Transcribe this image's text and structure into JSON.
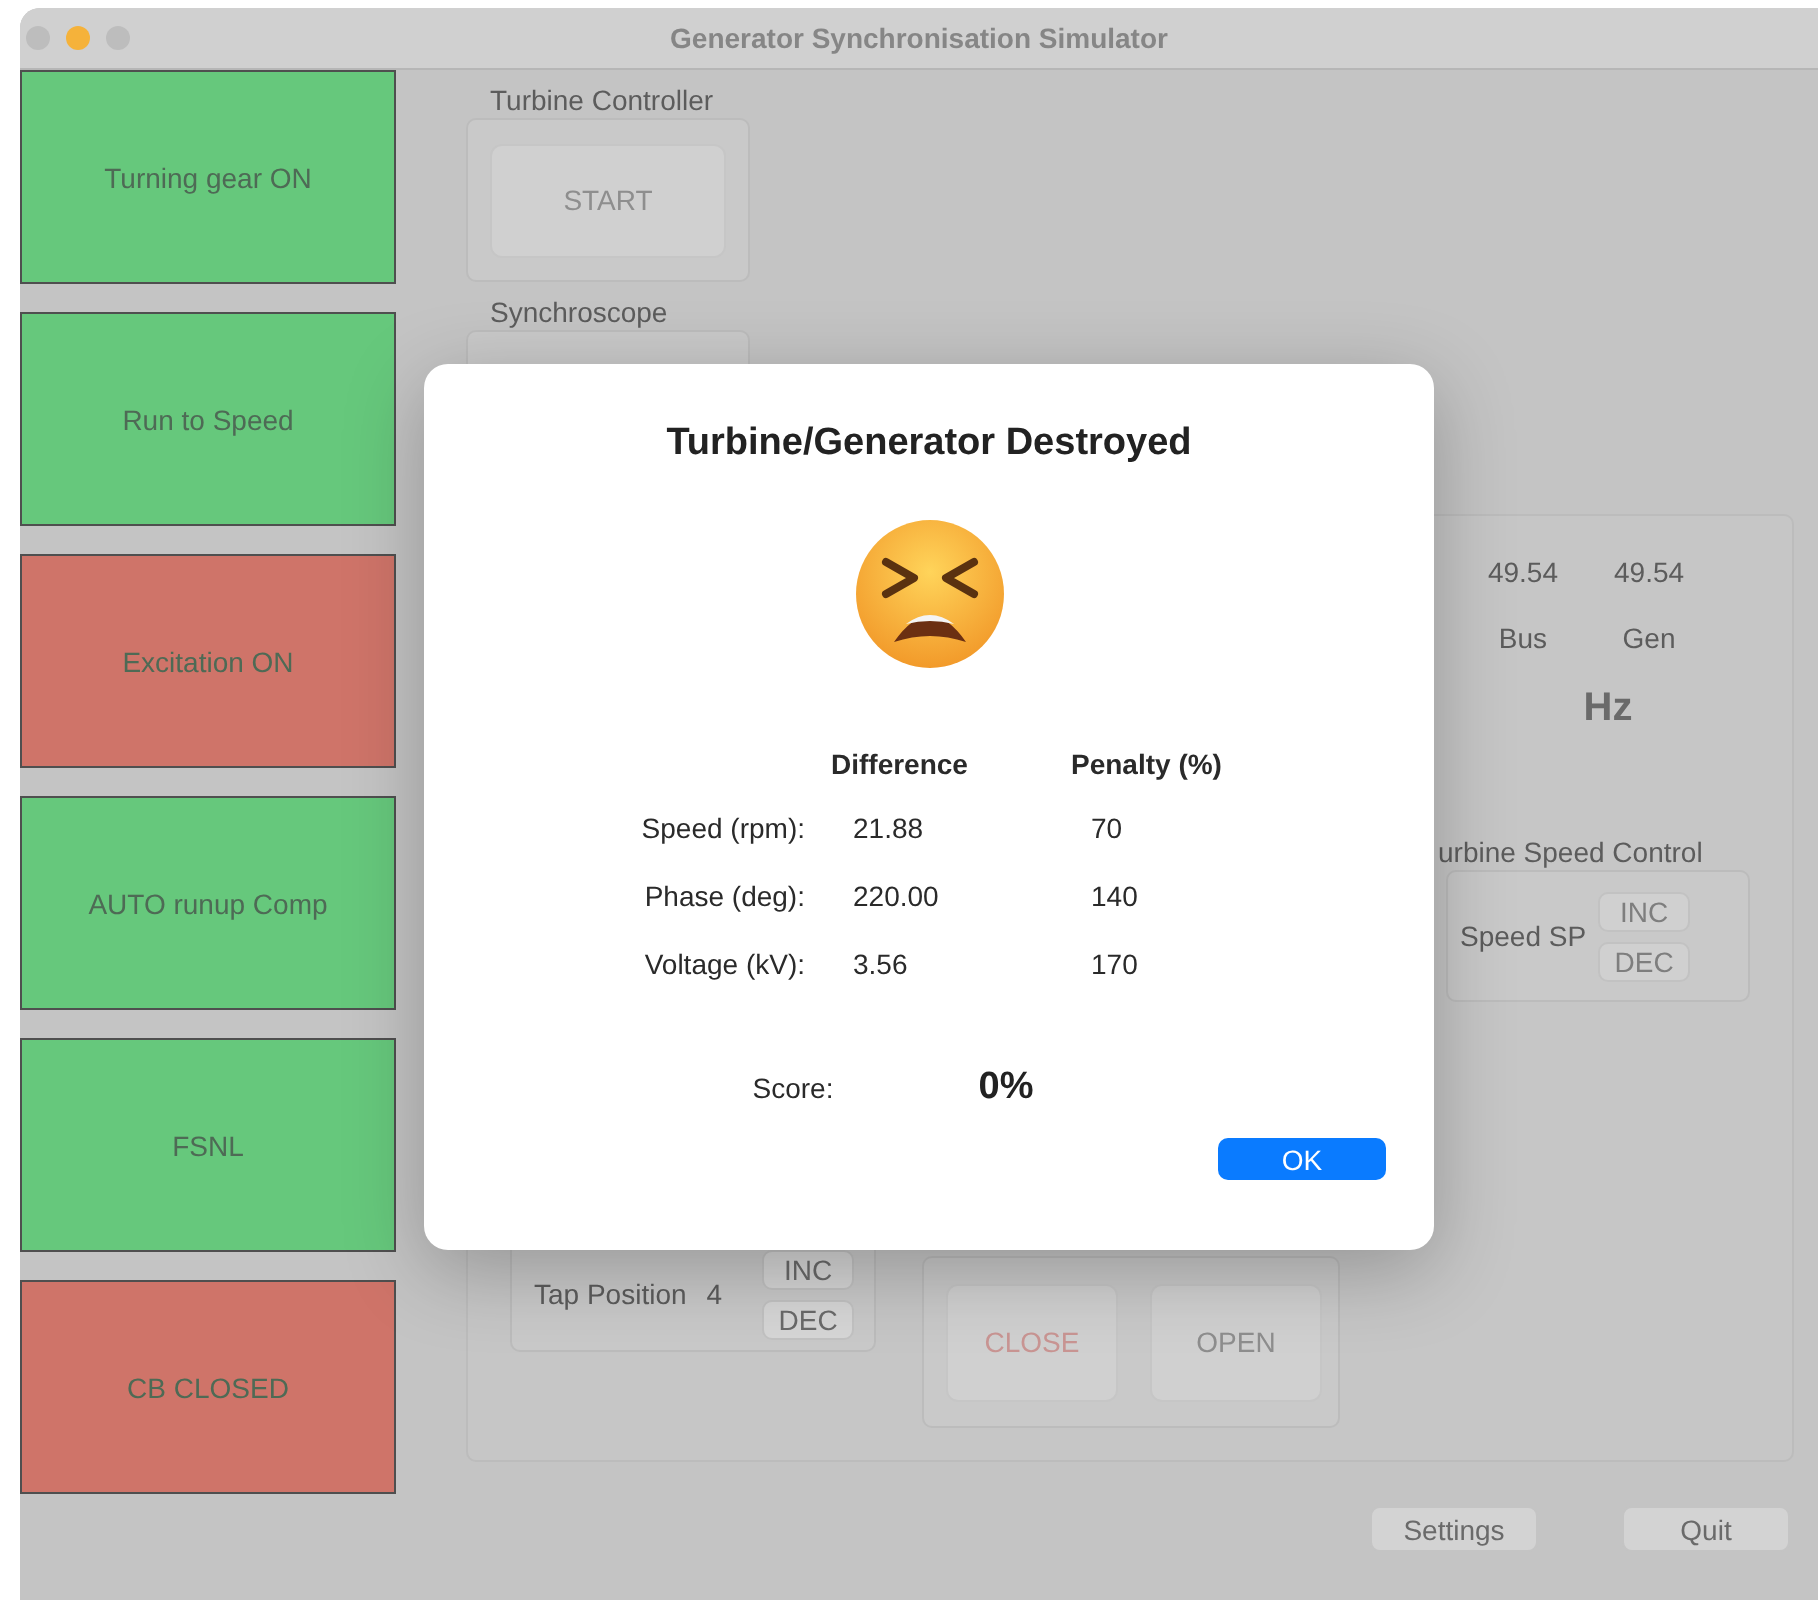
{
  "window": {
    "title": "Generator Synchronisation Simulator"
  },
  "status_buttons": [
    {
      "label": "Turning gear ON",
      "color": "#66c87c"
    },
    {
      "label": "Run to Speed",
      "color": "#66c87c"
    },
    {
      "label": "Excitation ON",
      "color": "#cf7469"
    },
    {
      "label": "AUTO runup Comp",
      "color": "#66c87c"
    },
    {
      "label": "FSNL",
      "color": "#66c87c"
    },
    {
      "label": "CB CLOSED",
      "color": "#cf7469"
    }
  ],
  "turbine_controller": {
    "label": "Turbine Controller",
    "button": "START"
  },
  "synchroscope": {
    "label": "Synchroscope"
  },
  "frequency": {
    "readings": [
      {
        "value": "49.54",
        "label": "Bus"
      },
      {
        "value": "49.54",
        "label": "Gen"
      }
    ],
    "unit": "Hz"
  },
  "speed_control": {
    "label": "urbine Speed Control",
    "setpoint_label": "Speed SP",
    "buttons": [
      "INC",
      "DEC"
    ]
  },
  "tap_changer": {
    "label": "Tap Position",
    "value": "4",
    "buttons": [
      "INC",
      "DEC"
    ]
  },
  "circuit_breaker": {
    "buttons": [
      {
        "label": "CLOSE",
        "color": "#c99593"
      },
      {
        "label": "OPEN",
        "color": "#8e8e8e"
      }
    ]
  },
  "footer_buttons": [
    "Settings",
    "Quit"
  ],
  "dialog": {
    "title": "Turbine/Generator Destroyed",
    "columns": [
      "Difference",
      "Penalty (%)"
    ],
    "rows": [
      {
        "label": "Speed (rpm):",
        "difference": "21.88",
        "penalty": "70"
      },
      {
        "label": "Phase (deg):",
        "difference": "220.00",
        "penalty": "140"
      },
      {
        "label": "Voltage (kV):",
        "difference": "3.56",
        "penalty": "170"
      }
    ],
    "score_label": "Score:",
    "score": "0%",
    "button": "OK"
  }
}
